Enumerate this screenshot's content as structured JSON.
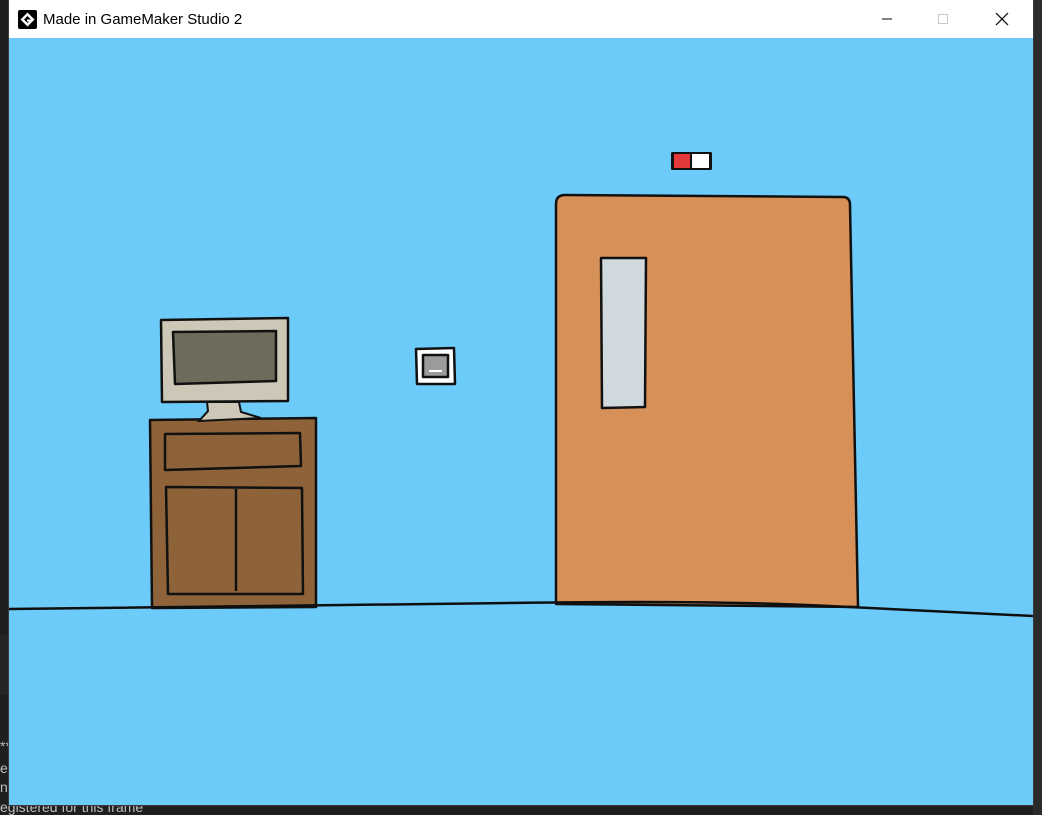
{
  "window": {
    "title": "Made in GameMaker Studio 2",
    "buttons": {
      "minimize": "minimize",
      "maximize": "maximize",
      "close": "close"
    }
  },
  "background_app": {
    "text_lines": [
      "**",
      "eg",
      "n",
      "egistered for this frame"
    ]
  },
  "colors": {
    "sky": "#6ccbf8",
    "floor_line": "#0f0f0f",
    "door": "#d69058",
    "door_window": "#d0d9dd",
    "cabinet": "#8f633a",
    "monitor_body": "#ccc7b6",
    "monitor_screen": "#6d6c5b",
    "indicator_red": "#e5383b",
    "indicator_white": "#ffffff",
    "wall_switch": "#9b9b9b"
  },
  "scene": {
    "objects": [
      {
        "name": "computer-monitor",
        "icon": "monitor-icon"
      },
      {
        "name": "wooden-cabinet",
        "icon": "cabinet-icon"
      },
      {
        "name": "light-switch",
        "icon": "switch-icon"
      },
      {
        "name": "door",
        "icon": "door-icon"
      },
      {
        "name": "door-indicator-light",
        "icon": "indicator-icon",
        "state": "red"
      }
    ]
  }
}
